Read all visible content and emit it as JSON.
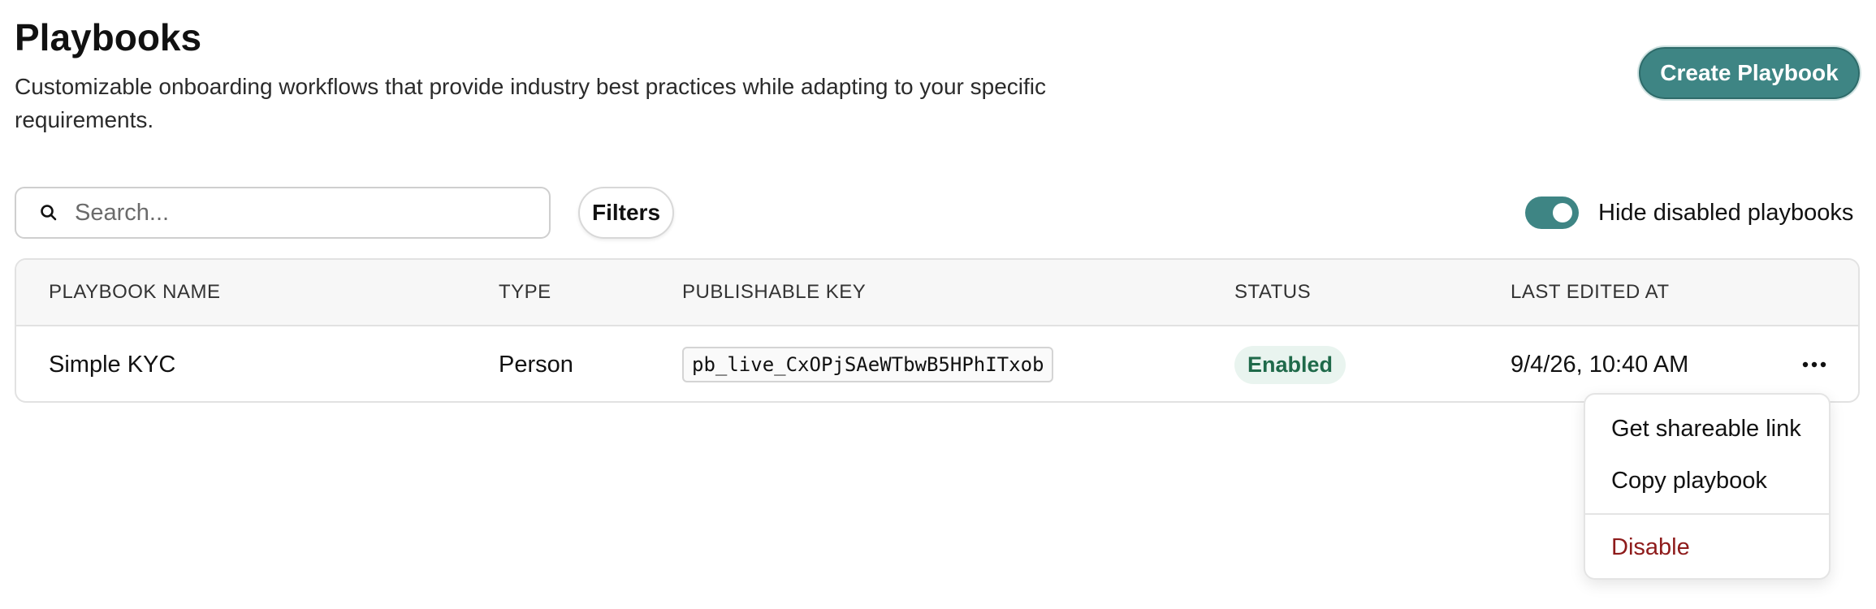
{
  "header": {
    "title": "Playbooks",
    "description": "Customizable onboarding workflows that provide industry best practices while adapting to your specific requirements.",
    "create_label": "Create Playbook"
  },
  "toolbar": {
    "search_placeholder": "Search...",
    "search_value": "",
    "filters_label": "Filters",
    "toggle_label": "Hide disabled playbooks",
    "toggle_on": true,
    "icons": {
      "search": "search-icon",
      "more": "more-horizontal-icon"
    }
  },
  "table": {
    "columns": [
      "PLAYBOOK NAME",
      "TYPE",
      "PUBLISHABLE KEY",
      "STATUS",
      "LAST EDITED AT"
    ],
    "rows": [
      {
        "name": "Simple KYC",
        "type": "Person",
        "key": "pb_live_CxOPjSAeWTbwB5HPhITxob",
        "status": "Enabled",
        "last_edited": "9/4/26, 10:40 AM"
      }
    ]
  },
  "row_menu": {
    "items": [
      "Get shareable link",
      "Copy playbook"
    ],
    "danger_item": "Disable"
  },
  "colors": {
    "accent": "#3e8584",
    "status_bg": "#e9f4ef",
    "status_text": "#1f6a4a",
    "danger": "#8e1b1b"
  }
}
